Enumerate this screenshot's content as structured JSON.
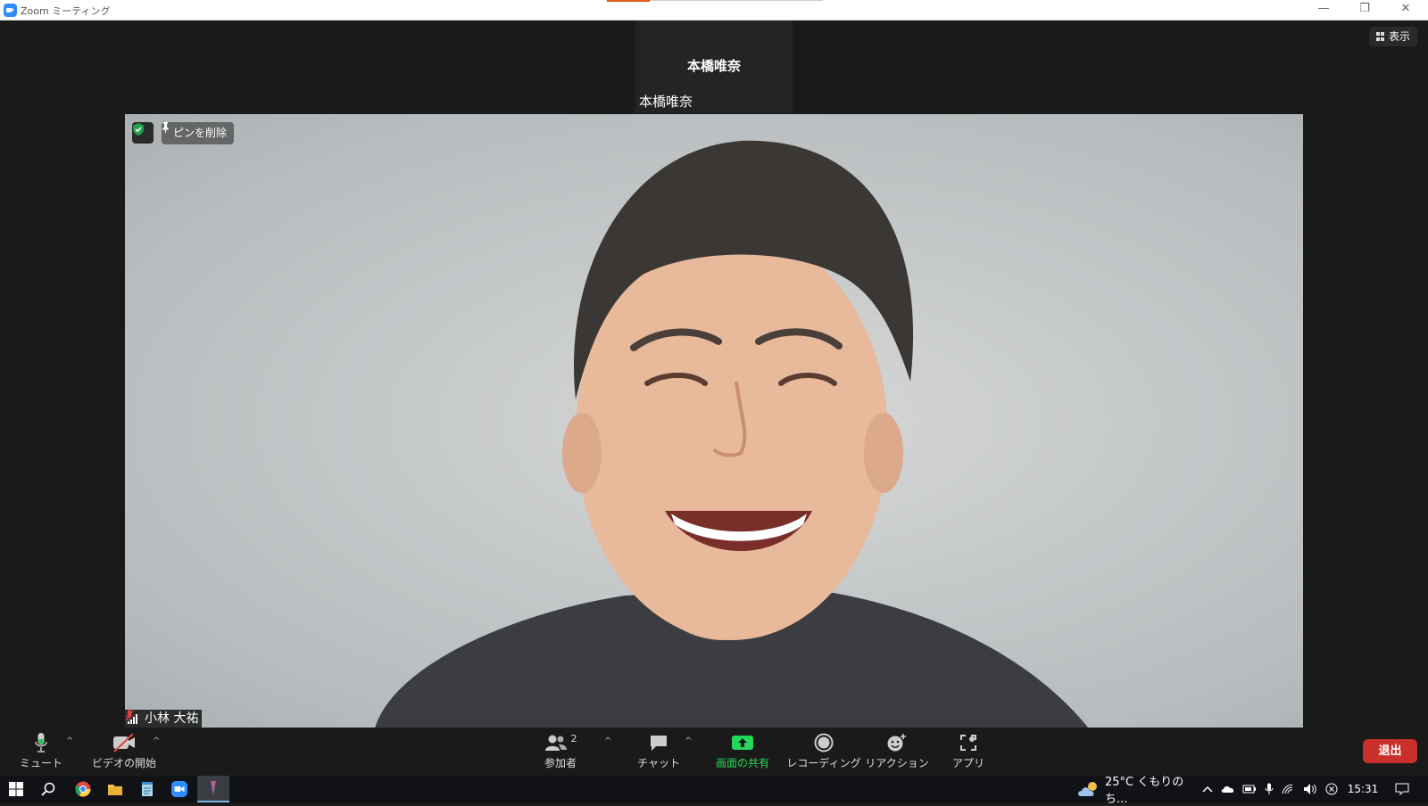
{
  "window": {
    "title": "Zoom ミーティング",
    "controls": {
      "minimize": "—",
      "restore": "❐",
      "close": "✕"
    }
  },
  "top_tile": {
    "name_center": "本橋唯奈",
    "name_label": "本橋唯奈"
  },
  "view_button": {
    "label": "表示"
  },
  "main_video": {
    "unpin_label": "ピンを削除",
    "participant_name": "小林 大祐",
    "muted": true,
    "encryption_icon": "shield-check-icon"
  },
  "toolbar": {
    "mute_label": "ミュート",
    "video_label": "ビデオの開始",
    "participants_label": "参加者",
    "participants_count": "2",
    "chat_label": "チャット",
    "share_label": "画面の共有",
    "record_label": "レコーディング",
    "reaction_label": "リアクション",
    "apps_label": "アプリ",
    "leave_label": "退出",
    "caret": "^"
  },
  "taskbar": {
    "weather": "25°C くもりのち...",
    "clock": "15:31"
  },
  "colors": {
    "share_green": "#23d959",
    "leave_red": "#c9302c",
    "zoom_blue": "#2d8cff",
    "shield_green": "#23a047"
  }
}
